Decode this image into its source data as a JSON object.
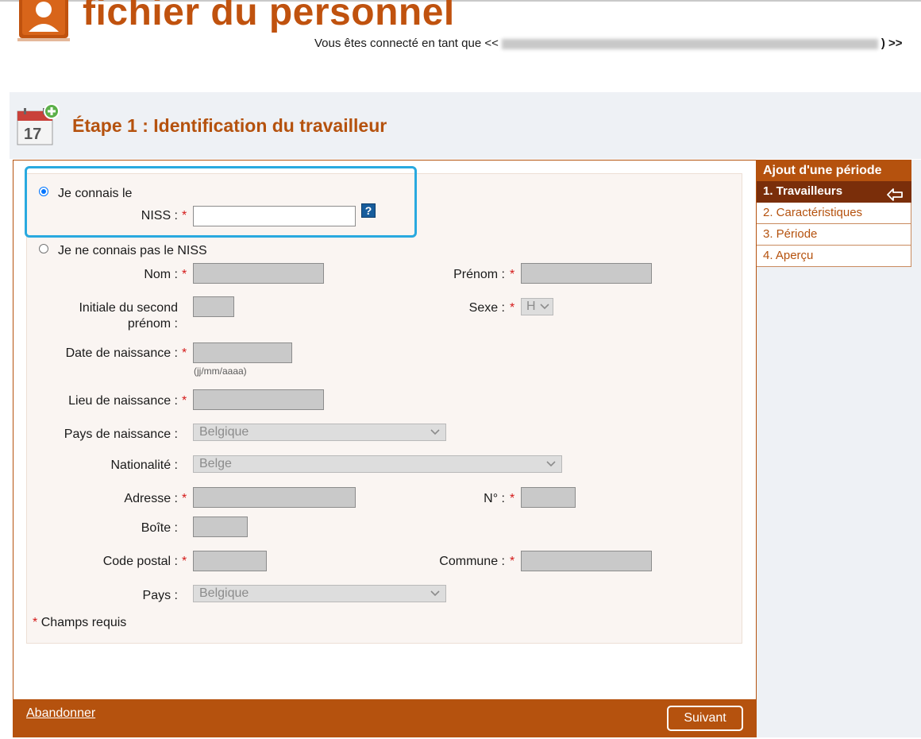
{
  "header": {
    "app_title": "fichier du personnel",
    "connected_prefix": "Vous êtes connecté en tant que <<",
    "connected_suffix": ") >>"
  },
  "step": {
    "calendar_day": "17",
    "title": "Étape 1 : Identification du travailleur"
  },
  "form": {
    "option_known": "Je connais le",
    "option_unknown": "Je ne connais pas le NISS",
    "niss_label": "NISS :",
    "niss_value": "",
    "help_label": "?",
    "required_mark": "*",
    "nom_label": "Nom :",
    "prenom_label": "Prénom :",
    "initiale_label_1": "Initiale du second",
    "initiale_label_2": "prénom :",
    "sexe_label": "Sexe :",
    "sexe_value": "H",
    "date_label": "Date de naissance :",
    "date_hint": "(jj/mm/aaaa)",
    "lieu_label": "Lieu de naissance :",
    "pays_naissance_label": "Pays de naissance :",
    "pays_naissance_value": "Belgique",
    "nationalite_label": "Nationalité :",
    "nationalite_value": "Belge",
    "adresse_label": "Adresse :",
    "numero_label": "N° :",
    "boite_label": "Boîte :",
    "code_postal_label": "Code postal :",
    "commune_label": "Commune :",
    "pays_label": "Pays :",
    "pays_value": "Belgique",
    "required_note": "Champs requis"
  },
  "footer": {
    "abandon_label": "Abandonner",
    "next_label": "Suivant"
  },
  "sidebar": {
    "heading": "Ajout d'une période",
    "items": [
      {
        "label": "1. Travailleurs",
        "active": true
      },
      {
        "label": "2. Caractéristiques",
        "active": false
      },
      {
        "label": "3. Période",
        "active": false
      },
      {
        "label": "4. Aperçu",
        "active": false
      }
    ]
  },
  "colors": {
    "brand": "#b5520e",
    "highlight": "#29a9df",
    "required": "#d41a1a"
  }
}
